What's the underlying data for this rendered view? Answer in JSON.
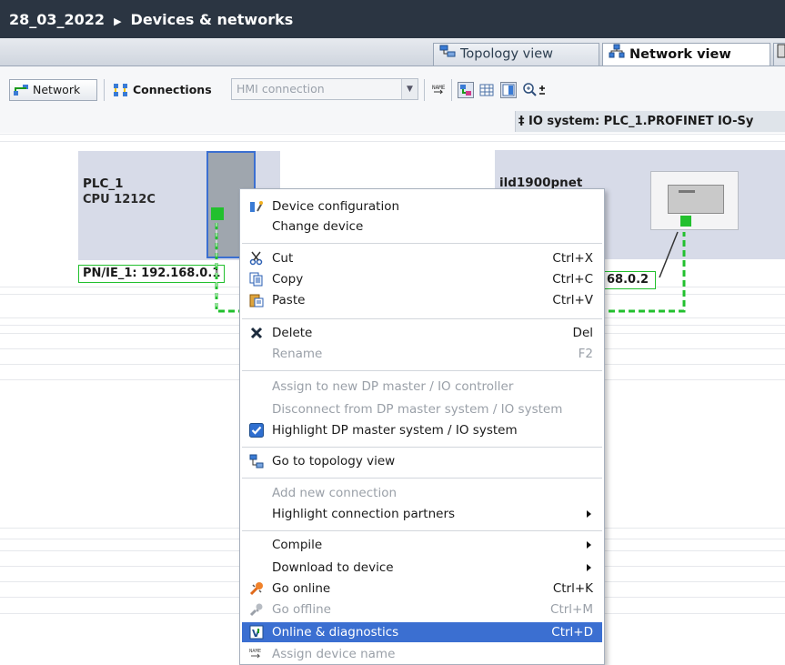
{
  "header": {
    "project": "28_03_2022",
    "separator": "▶",
    "page": "Devices & networks"
  },
  "tabs": [
    {
      "label": "Topology view",
      "active": false
    },
    {
      "label": "Network view",
      "active": true
    }
  ],
  "toolbar": {
    "network_label": "Network",
    "connections_label": "Connections",
    "connection_type_value": "HMI connection",
    "zoom_icon": "zoom-in-icon"
  },
  "io_system": {
    "label": "IO system: PLC_1.PROFINET IO-Sy"
  },
  "devices": {
    "plc": {
      "name": "PLC_1",
      "type": "CPU 1212C",
      "ip_label": "PN/IE_1: 192.168.0.1"
    },
    "ild": {
      "name": "ild1900pnet",
      "ip_label": "68.0.2"
    }
  },
  "context_menu": {
    "items": [
      {
        "label": "Device configuration",
        "shortcut": "",
        "disabled": false,
        "icon": "device-config-icon"
      },
      {
        "label": "Change device",
        "shortcut": "",
        "disabled": false,
        "icon": ""
      },
      {
        "label": "Cut",
        "shortcut": "Ctrl+X",
        "disabled": false,
        "icon": "scissors-icon"
      },
      {
        "label": "Copy",
        "shortcut": "Ctrl+C",
        "disabled": false,
        "icon": "copy-icon"
      },
      {
        "label": "Paste",
        "shortcut": "Ctrl+V",
        "disabled": false,
        "icon": "paste-icon"
      },
      {
        "label": "Delete",
        "shortcut": "Del",
        "disabled": false,
        "icon": "delete-x-icon"
      },
      {
        "label": "Rename",
        "shortcut": "F2",
        "disabled": true,
        "icon": ""
      },
      {
        "label": "Assign to new DP master / IO controller",
        "shortcut": "",
        "disabled": true,
        "icon": ""
      },
      {
        "label": "Disconnect from DP master system / IO system",
        "shortcut": "",
        "disabled": true,
        "icon": ""
      },
      {
        "label": "Highlight DP master system / IO system",
        "shortcut": "",
        "disabled": false,
        "icon": "checkbox-checked-icon"
      },
      {
        "label": "Go to topology view",
        "shortcut": "",
        "disabled": false,
        "icon": "topology-icon"
      },
      {
        "label": "Add new connection",
        "shortcut": "",
        "disabled": true,
        "icon": ""
      },
      {
        "label": "Highlight connection partners",
        "shortcut": "",
        "disabled": false,
        "icon": "",
        "submenu": true
      },
      {
        "label": "Compile",
        "shortcut": "",
        "disabled": false,
        "icon": "",
        "submenu": true
      },
      {
        "label": "Download to device",
        "shortcut": "",
        "disabled": false,
        "icon": "",
        "submenu": true
      },
      {
        "label": "Go online",
        "shortcut": "Ctrl+K",
        "disabled": false,
        "icon": "go-online-icon"
      },
      {
        "label": "Go offline",
        "shortcut": "Ctrl+M",
        "disabled": true,
        "icon": "go-offline-icon"
      },
      {
        "label": "Online & diagnostics",
        "shortcut": "Ctrl+D",
        "disabled": false,
        "highlighted": true,
        "icon": "diagnostics-icon"
      },
      {
        "label": "Assign device name",
        "shortcut": "",
        "disabled": true,
        "icon": "name-tag-icon"
      }
    ]
  },
  "colors": {
    "titlebar": "#2b3542",
    "highlight": "#3b6fd1",
    "profinet_green": "#22c02e",
    "device_box": "#d7dbe8"
  }
}
